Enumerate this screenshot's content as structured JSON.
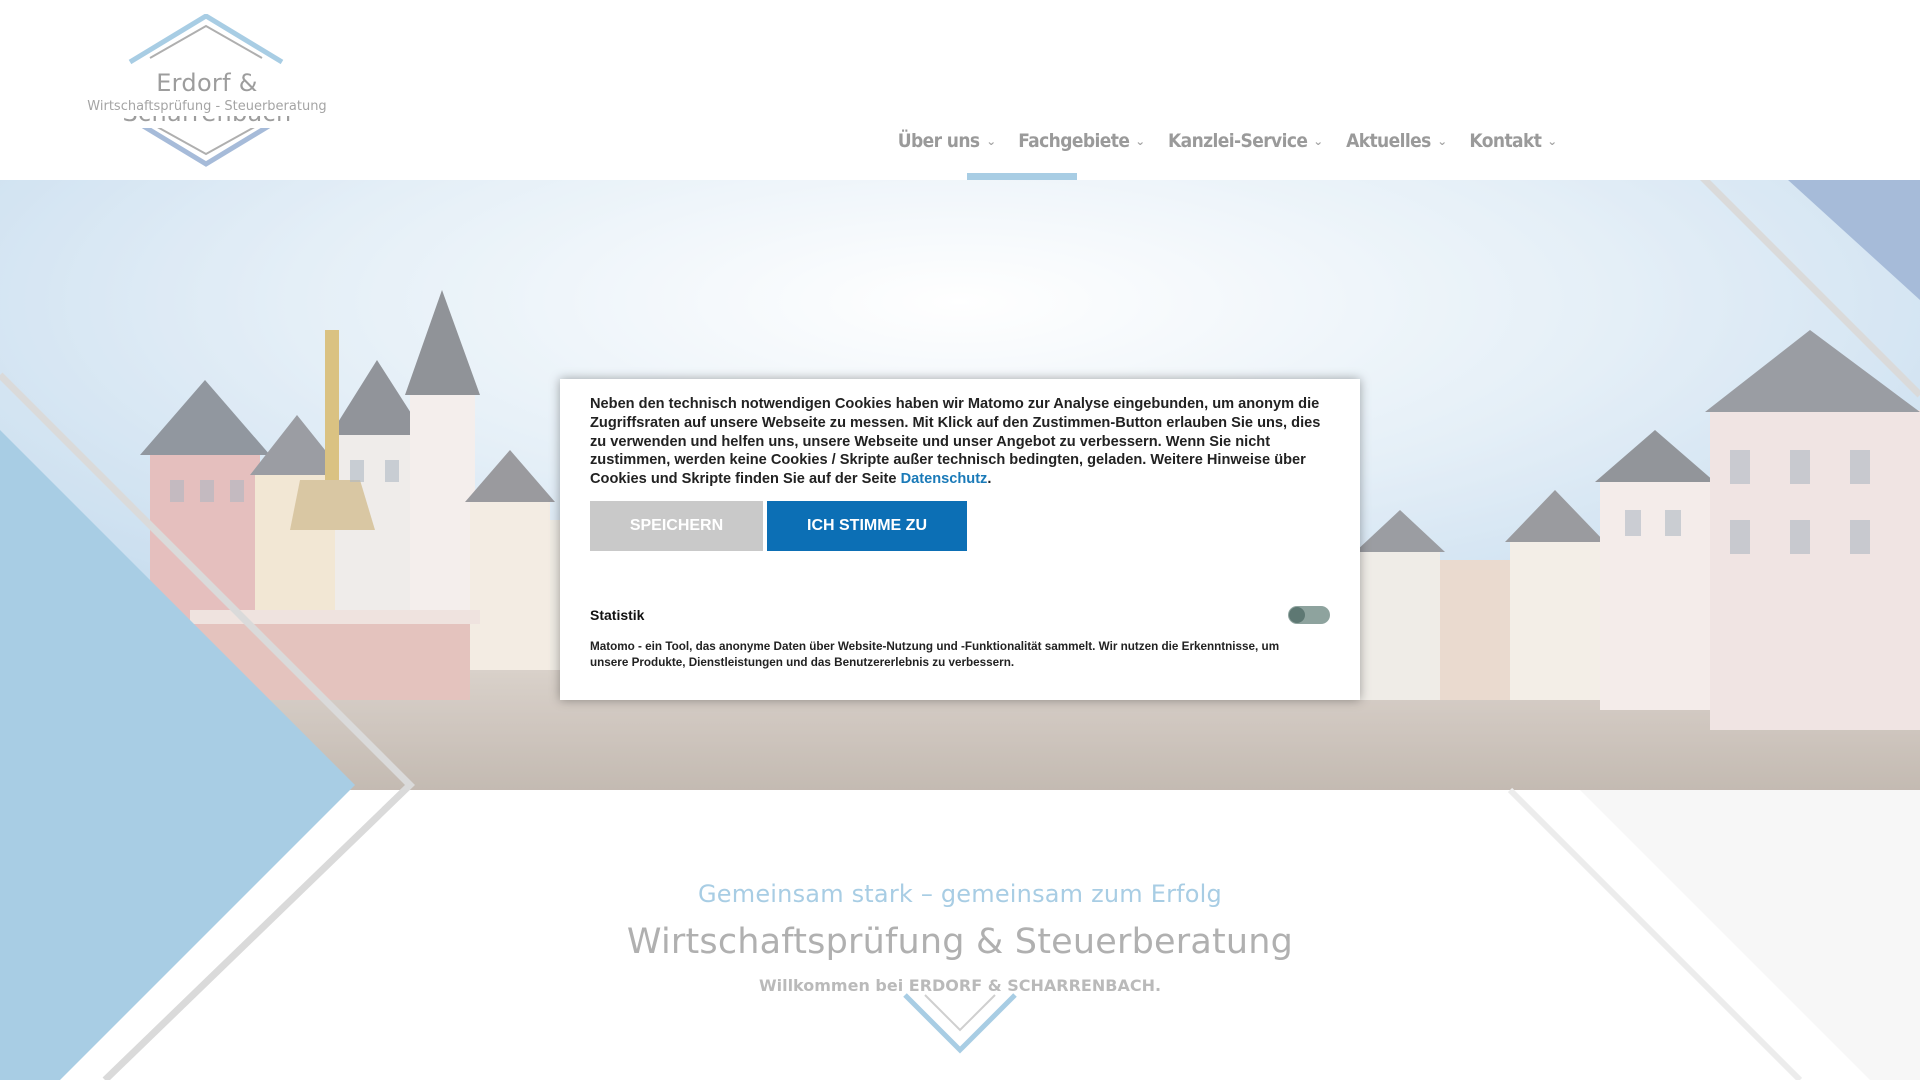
{
  "header": {
    "logo": {
      "name": "Erdorf & Scharrenbach",
      "tagline": "Wirtschaftsprüfung - Steuerberatung"
    },
    "nav": [
      {
        "label": "Über uns",
        "icon": "chevron-down-icon",
        "active": true
      },
      {
        "label": "Fachgebiete",
        "icon": "chevron-down-icon",
        "active": false
      },
      {
        "label": "Kanzlei-Service",
        "icon": "chevron-down-icon",
        "active": false
      },
      {
        "label": "Aktuelles",
        "icon": "chevron-down-icon",
        "active": false
      },
      {
        "label": "Kontakt",
        "icon": "chevron-down-icon",
        "active": false
      }
    ]
  },
  "intro": {
    "kicker": "Gemeinsam stark – gemeinsam zum Erfolg",
    "title": "Wirtschaftsprüfung & Steuerberatung",
    "welcome": "Willkommen bei ERDORF & SCHARRENBACH."
  },
  "cookie_dialog": {
    "text_before_link": "Neben den technisch notwendigen Cookies haben wir Matomo zur Analyse eingebunden, um anonym die Zugriffsraten auf unsere Webseite zu messen. Mit Klick auf den Zustimmen-Button erlauben Sie uns, dies zu verwenden und helfen uns, unsere Webseite und unser Angebot zu verbessern. Wenn Sie nicht zustimmen, werden keine Cookies / Skripte außer technisch bedingten, geladen. Weitere Hinweise über Cookies und Skripte finden Sie auf der Seite ",
    "link_label": "Datenschutz",
    "text_after_link": ".",
    "save_label": "Speichern",
    "agree_label": "Ich stimme zu",
    "statistics_label": "Statistik",
    "statistics_enabled": false,
    "statistics_description": "Matomo - ein Tool, das anonyme Daten über Website-Nutzung und -Funktionalität sammelt. Wir nutzen die Erkenntnisse, um unsere Produkte, Dienstleistungen und das Benutzererlebnis zu verbessern."
  },
  "colors": {
    "accent_light_blue": "#7fb6d8",
    "button_blue": "#0c6fb5",
    "button_grey": "#c9c9c9",
    "corner_dark_blue": "#7c9bc8"
  }
}
